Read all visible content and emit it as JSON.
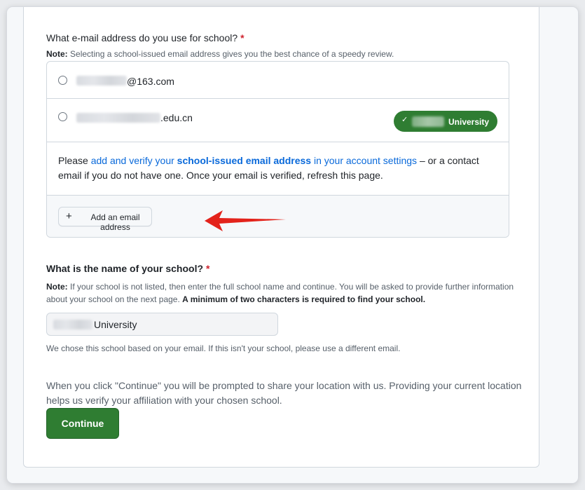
{
  "email_question": {
    "title": "What e-mail address do you use for school?",
    "required_mark": "*",
    "note_label": "Note:",
    "note_text": "Selecting a school-issued email address gives you the best chance of a speedy review."
  },
  "emails": [
    {
      "suffix": "@163.com",
      "selected": false
    },
    {
      "suffix": ".edu.cn",
      "selected": false,
      "badge": {
        "icon": "check-icon",
        "text": "University"
      }
    }
  ],
  "verify_help": {
    "prefix": "Please ",
    "link1": "add and verify your ",
    "link_bold": "school-issued email address",
    "link2": " in your account settings",
    "suffix": " – or a contact email if you do not have one. Once your email is verified, refresh this page."
  },
  "add_email_button": {
    "icon": "plus-icon",
    "label": "Add an email address"
  },
  "school_question": {
    "title": "What is the name of your school?",
    "required_mark": "*",
    "note_label": "Note:",
    "note_text": " If your school is not listed, then enter the full school name and continue. You will be asked to provide further information about your school on the next page. ",
    "note_bold": "A minimum of two characters is required to find your school."
  },
  "school_input": {
    "value_suffix": "University"
  },
  "school_hint": "We chose this school based on your email. If this isn't your school, please use a different email.",
  "location_info": "When you click \"Continue\" you will be prompted to share your location with us. Providing your current location helps us verify your affiliation with your chosen school.",
  "continue_button": {
    "label": "Continue"
  },
  "colors": {
    "accent_green": "#2f7d32",
    "link_blue": "#0969da",
    "required_red": "#cf222e",
    "arrow_red": "#e3231b"
  }
}
